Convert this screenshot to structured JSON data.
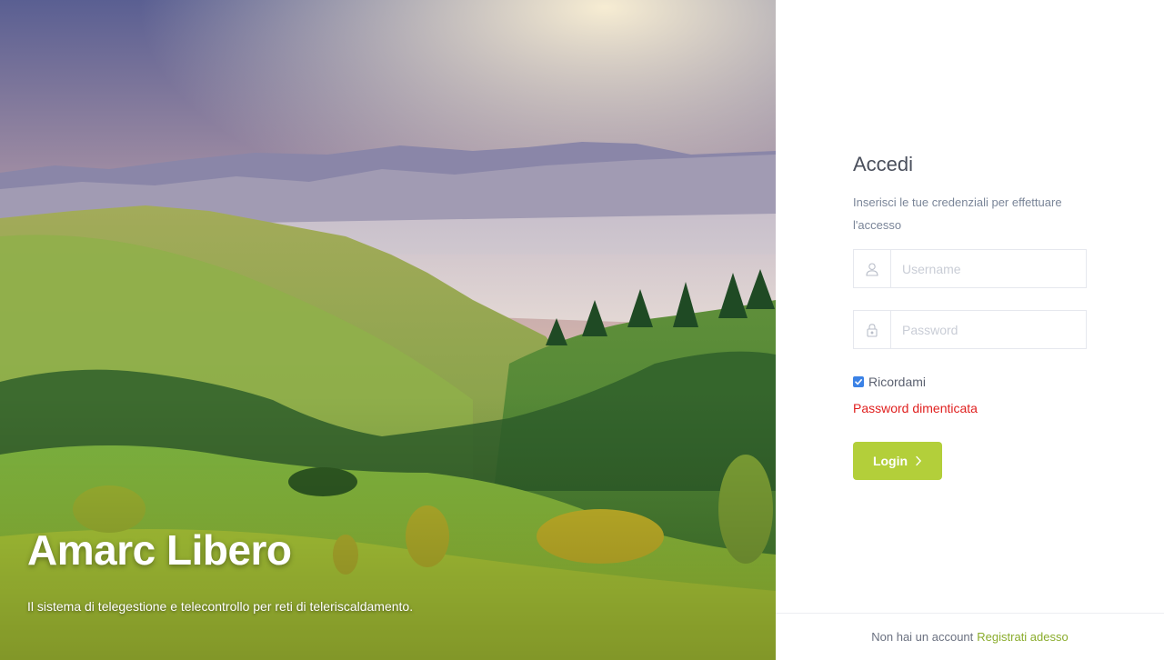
{
  "hero": {
    "title": "Amarc Libero",
    "subtitle": "Il sistema di telegestione e telecontrollo per reti di teleriscaldamento."
  },
  "login": {
    "title": "Accedi",
    "description": "Inserisci le tue credenziali per effettuare l'accesso",
    "username": {
      "placeholder": "Username",
      "value": "",
      "icon": "user-icon"
    },
    "password": {
      "placeholder": "Password",
      "value": "",
      "icon": "lock-icon"
    },
    "remember": {
      "label": "Ricordami",
      "checked": true
    },
    "forgot_label": "Password dimenticata",
    "submit_label": "Login",
    "submit_icon": "chevron-right-icon"
  },
  "footer": {
    "text": "Non hai un account",
    "link_label": "Registrati adesso"
  },
  "colors": {
    "accent": "#b3cf3a",
    "link_green": "#8aac2c",
    "danger": "#e0201f",
    "checkbox": "#3b82e6"
  }
}
